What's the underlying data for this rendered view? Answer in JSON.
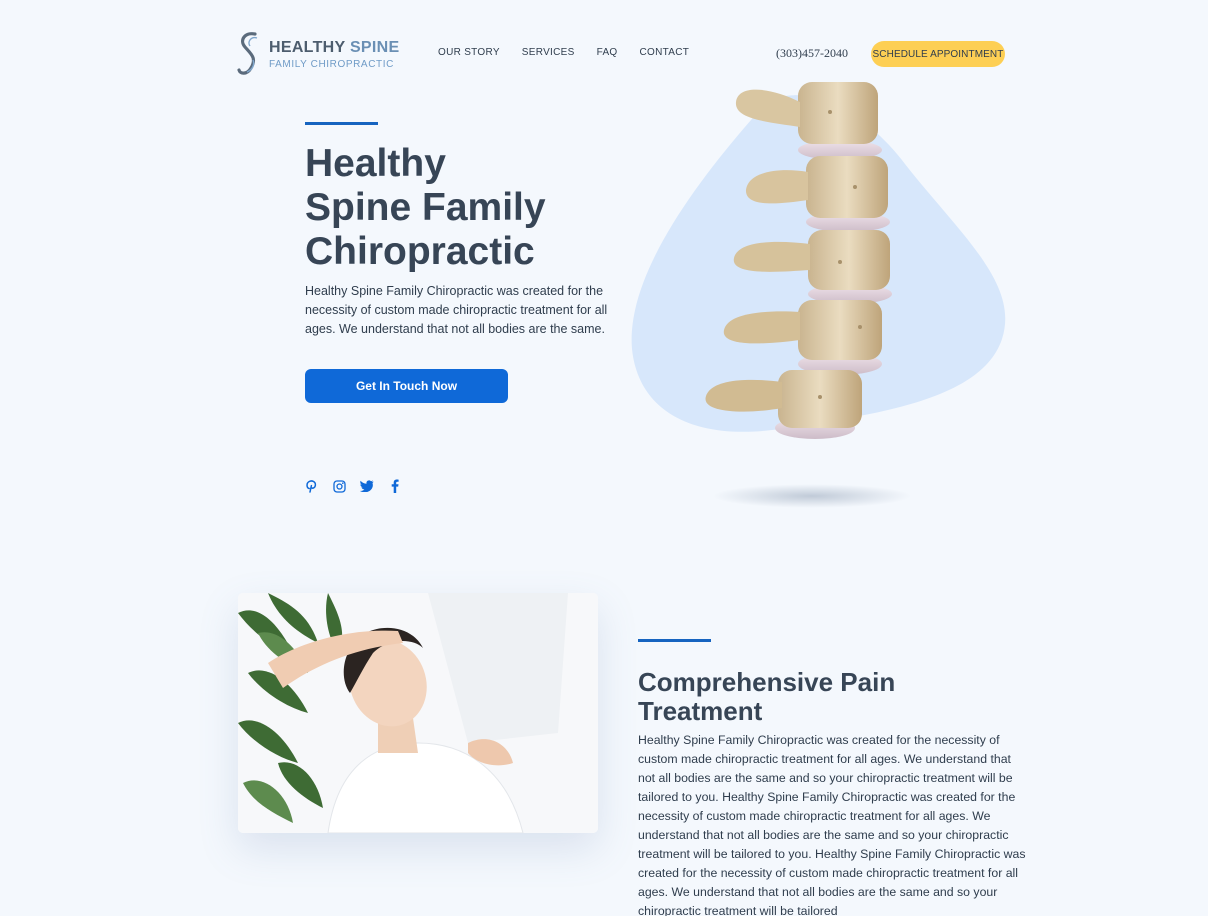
{
  "brand": {
    "name_part1": "HEALTHY",
    "name_part2": "SPINE",
    "subtitle": "FAMILY CHIROPRACTIC"
  },
  "nav": {
    "items": [
      {
        "label": "OUR STORY"
      },
      {
        "label": "SERVICES"
      },
      {
        "label": "FAQ"
      },
      {
        "label": "CONTACT"
      }
    ]
  },
  "header": {
    "phone": "(303)457-2040",
    "schedule_label": "SCHEDULE APPOINTMENT"
  },
  "hero": {
    "title_lines": [
      "Healthy",
      "Spine Family",
      "Chiropractic"
    ],
    "description": "Healthy Spine Family Chiropractic was created for the necessity of custom made chiropractic treatment for all ages. We understand that not all bodies are the same.",
    "button_label": "Get In Touch Now"
  },
  "social": [
    {
      "icon": "pinterest-icon"
    },
    {
      "icon": "instagram-icon"
    },
    {
      "icon": "twitter-icon"
    },
    {
      "icon": "facebook-icon"
    }
  ],
  "treatment": {
    "title_lines": [
      "Comprehensive Pain",
      "Treatment"
    ],
    "description": "Healthy Spine Family Chiropractic was created for the necessity of  custom made chiropractic treatment for all ages. We understand that not all bodies are the same and so your chiropractic treatment will be tailored to you. Healthy Spine Family Chiropractic was created for the necessity of custom made chiropractic treatment for all ages. We understand that not all bodies are the same and so your chiropractic treatment will be tailored to you. Healthy Spine Family Chiropractic was created for the necessity of custom made chiropractic treatment for all ages. We understand that not all bodies are the same and so your chiropractic treatment will be tailored"
  },
  "colors": {
    "accent_blue": "#0f69d8",
    "cta_yellow": "#fdcf54",
    "heading": "#374556",
    "background": "#f4f8fd",
    "blob": "#d7e7fb"
  }
}
